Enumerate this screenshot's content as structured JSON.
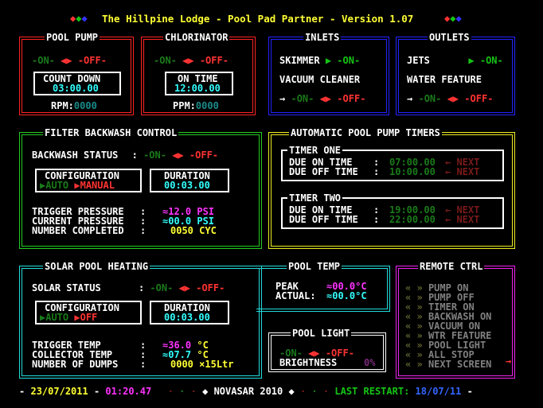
{
  "header": {
    "title": "The Hillpine Lodge - Pool Pad Partner - Version 1.07",
    "colors": {
      "red": "#ff3333",
      "green": "#15c415",
      "blue": "#3333ff",
      "yellow": "#ffff33",
      "cyan": "#33ffff",
      "magenta": "#ff33ff"
    }
  },
  "pool_pump": {
    "title": "POOL PUMP",
    "on": "-ON-",
    "off": "-OFF-",
    "count_down_label": "COUNT DOWN",
    "count_down_value": "03:00.00",
    "rpm_label": "RPM:",
    "rpm_value": "0000"
  },
  "chlorinator": {
    "title": "CHLORINATOR",
    "on": "-ON-",
    "off": "-OFF-",
    "on_time_label": "ON TIME",
    "on_time_value": "12:00.00",
    "ppm_label": "PPM:",
    "ppm_value": "0000"
  },
  "inlets": {
    "title": "INLETS",
    "skimmer": "SKIMMER",
    "skimmer_state": "-ON-",
    "vacuum": "VACUUM CLEANER",
    "arrow": "→",
    "on": "-ON-",
    "off": "-OFF-"
  },
  "outlets": {
    "title": "OUTLETS",
    "jets": "JETS",
    "jets_state": "-ON-",
    "water_feature": "WATER FEATURE",
    "arrow": "→",
    "on": "-ON-",
    "off": "-OFF-"
  },
  "filter": {
    "title": "FILTER BACKWASH CONTROL",
    "backwash_status": "BACKWASH STATUS",
    "colon": ":",
    "on": "-ON-",
    "off": "-OFF-",
    "configuration": "CONFIGURATION",
    "auto": "AUTO",
    "manual": "MANUAL",
    "duration_label": "DURATION",
    "duration_value": "00:03.00",
    "trigger_pressure": "TRIGGER PRESSURE",
    "trigger_value": "≈12.0",
    "current_pressure": "CURRENT PRESSURE",
    "current_value": "≈00.0",
    "psi": "PSI",
    "number_completed": "NUMBER COMPLETED",
    "completed_value": "0050",
    "cyc": "CYC"
  },
  "timers": {
    "title": "AUTOMATIC POOL PUMP TIMERS",
    "timer_one": "TIMER ONE",
    "timer_two": "TIMER TWO",
    "due_on": "DUE ON TIME",
    "due_off": "DUE OFF TIME",
    "colon": ":",
    "t1_on": "07:00.00",
    "t1_off": "10:00.00",
    "t2_on": "19:00.00",
    "t2_off": "22:00.00",
    "next": "← NEXT"
  },
  "solar": {
    "title": "SOLAR POOL HEATING",
    "solar_status": "SOLAR STATUS",
    "colon": ":",
    "on": "-ON-",
    "off": "-OFF-",
    "configuration": "CONFIGURATION",
    "auto": "AUTO",
    "off_label": "OFF",
    "duration_label": "DURATION",
    "duration_value": "00:03.00",
    "trigger_temp": "TRIGGER TEMP",
    "trigger_value": "≈36.0",
    "collector_temp": "COLLECTOR TEMP",
    "collector_value": "≈07.7",
    "deg_c": "°C",
    "dumps": "NUMBER OF DUMPS",
    "dumps_value": "0000",
    "dumps_unit": "×15Ltr"
  },
  "pool_temp": {
    "title": "POOL TEMP",
    "peak": "PEAK",
    "peak_value": "≈00.0°C",
    "actual": "ACTUAL:",
    "actual_value": "≈00.0°C"
  },
  "pool_light": {
    "title": "POOL LIGHT",
    "on": "-ON-",
    "off": "-OFF-",
    "brightness": "BRIGHTNESS",
    "brightness_value": "0%"
  },
  "remote": {
    "title": "REMOTE CTRL",
    "items": [
      "PUMP ON",
      "PUMP OFF",
      "TIMER ON",
      "BACKWASH ON",
      "VACUUM ON",
      "WTR FEATURE",
      "POOL LIGHT",
      "ALL STOP",
      "NEXT SCREEN"
    ]
  },
  "footer": {
    "date": "23/07/2011",
    "time": "01:20.47",
    "brand": "NOVASAR 2010",
    "last_restart_label": "LAST RESTART:",
    "last_restart_value": "18/07/11"
  }
}
